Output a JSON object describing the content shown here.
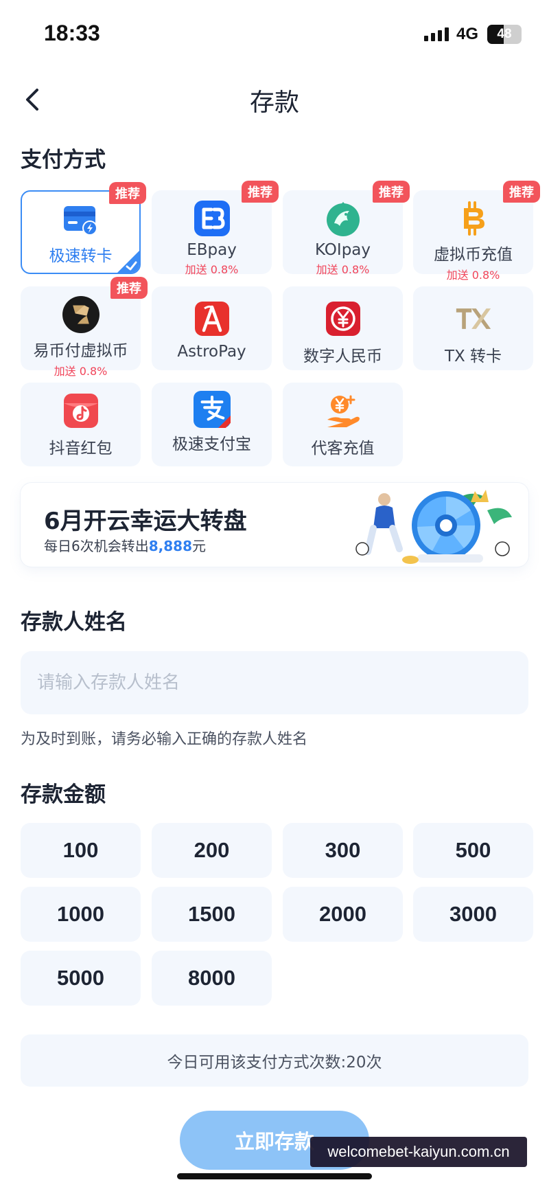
{
  "status_bar": {
    "time": "18:33",
    "network": "4G",
    "battery": "48",
    "battery_level": 0.48
  },
  "nav": {
    "title": "存款",
    "back_icon": "chevron-left-icon"
  },
  "payment": {
    "section_title": "支付方式",
    "methods": [
      {
        "label": "极速转卡",
        "badge": "推荐",
        "bonus": "",
        "selected": true,
        "icon": "card-lightning-icon"
      },
      {
        "label": "EBpay",
        "badge": "推荐",
        "bonus": "加送 0.8%",
        "selected": false,
        "icon": "ebpay-icon"
      },
      {
        "label": "KOIpay",
        "badge": "推荐",
        "bonus": "加送 0.8%",
        "selected": false,
        "icon": "koi-fish-icon"
      },
      {
        "label": "虚拟币充值",
        "badge": "推荐",
        "bonus": "加送 0.8%",
        "selected": false,
        "icon": "bitcoin-icon"
      },
      {
        "label": "易币付虚拟币",
        "badge": "推荐",
        "bonus": "加送 0.8%",
        "selected": false,
        "icon": "yibifu-icon"
      },
      {
        "label": "AstroPay",
        "badge": "",
        "bonus": "",
        "selected": false,
        "icon": "astropay-icon"
      },
      {
        "label": "数字人民币",
        "badge": "",
        "bonus": "",
        "selected": false,
        "icon": "digital-rmb-icon"
      },
      {
        "label": "TX 转卡",
        "badge": "",
        "bonus": "",
        "selected": false,
        "icon": "tx-logo-icon"
      },
      {
        "label": "抖音红包",
        "badge": "",
        "bonus": "",
        "selected": false,
        "icon": "douyin-redpacket-icon"
      },
      {
        "label": "极速支付宝",
        "badge": "",
        "bonus": "",
        "selected": false,
        "icon": "alipay-icon"
      },
      {
        "label": "代客充值",
        "badge": "",
        "bonus": "",
        "selected": false,
        "icon": "hand-coin-icon"
      }
    ]
  },
  "promo": {
    "title": "6月开云幸运大转盘",
    "subtitle_prefix": "每日6次机会转出",
    "amount": "8,888",
    "subtitle_suffix": "元"
  },
  "depositor": {
    "section_title": "存款人姓名",
    "placeholder": "请输入存款人姓名",
    "value": "",
    "hint": "为及时到账，请务必输入正确的存款人姓名"
  },
  "amount": {
    "section_title": "存款金额",
    "options": [
      "100",
      "200",
      "300",
      "500",
      "1000",
      "1500",
      "2000",
      "3000",
      "5000",
      "8000"
    ]
  },
  "usage_text": "今日可用该支付方式次数:20次",
  "deposit_button": "立即存款",
  "watermark": "welcomebet-kaiyun.com.cn",
  "colors": {
    "accent": "#2f7ff0",
    "badge": "#f2545b",
    "card_bg": "#f3f7fd",
    "button": "#8dc3f7"
  }
}
